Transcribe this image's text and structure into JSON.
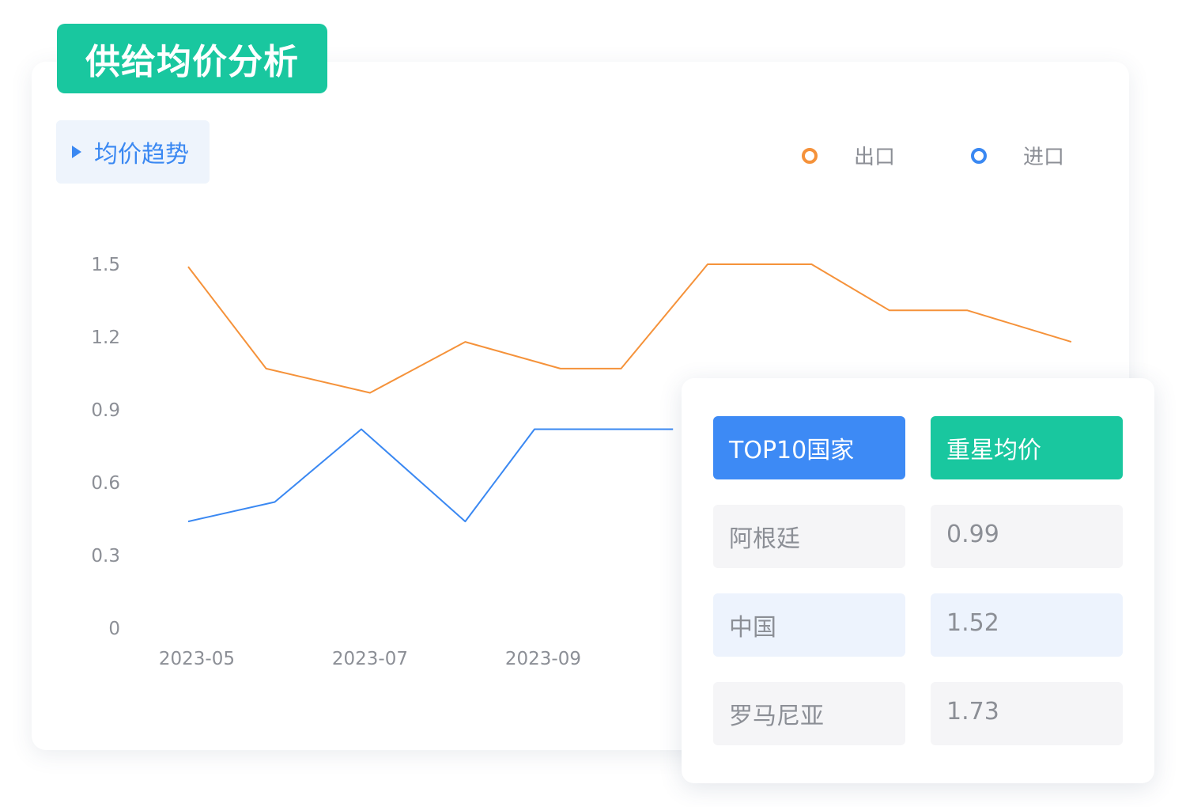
{
  "title": "供给均价分析",
  "tab": {
    "label": "均价趋势"
  },
  "legend": [
    {
      "name": "出口",
      "color": "#f5923a"
    },
    {
      "name": "进口",
      "color": "#3a88f2"
    }
  ],
  "chart_data": {
    "type": "line",
    "y_ticks": [
      "1.5",
      "1.2",
      "0.9",
      "0.6",
      "0.3",
      "0"
    ],
    "ylim": [
      0,
      1.5
    ],
    "x_tick_labels": [
      {
        "label": "2023-05",
        "x": 0.1
      },
      {
        "label": "2023-07",
        "x": 2.1
      },
      {
        "label": "2023-09",
        "x": 4.1
      }
    ],
    "series": [
      {
        "name": "出口",
        "color": "#f5923a",
        "points": [
          [
            0,
            1.49
          ],
          [
            0.9,
            1.07
          ],
          [
            2.1,
            0.97
          ],
          [
            3.2,
            1.18
          ],
          [
            4.3,
            1.07
          ],
          [
            5.0,
            1.07
          ],
          [
            6.0,
            1.5
          ],
          [
            7.2,
            1.5
          ],
          [
            8.1,
            1.31
          ],
          [
            9.0,
            1.31
          ],
          [
            10.2,
            1.18
          ]
        ]
      },
      {
        "name": "进口",
        "color": "#3a88f2",
        "points": [
          [
            0,
            0.44
          ],
          [
            1.0,
            0.52
          ],
          [
            2.0,
            0.82
          ],
          [
            3.2,
            0.44
          ],
          [
            4.0,
            0.82
          ],
          [
            5.6,
            0.82
          ]
        ]
      }
    ]
  },
  "table": {
    "headers": [
      "TOP10国家",
      "重星均价"
    ],
    "rows": [
      {
        "country": "阿根廷",
        "price": "0.99"
      },
      {
        "country": "中国",
        "price": "1.52"
      },
      {
        "country": "罗马尼亚",
        "price": "1.73"
      }
    ]
  }
}
